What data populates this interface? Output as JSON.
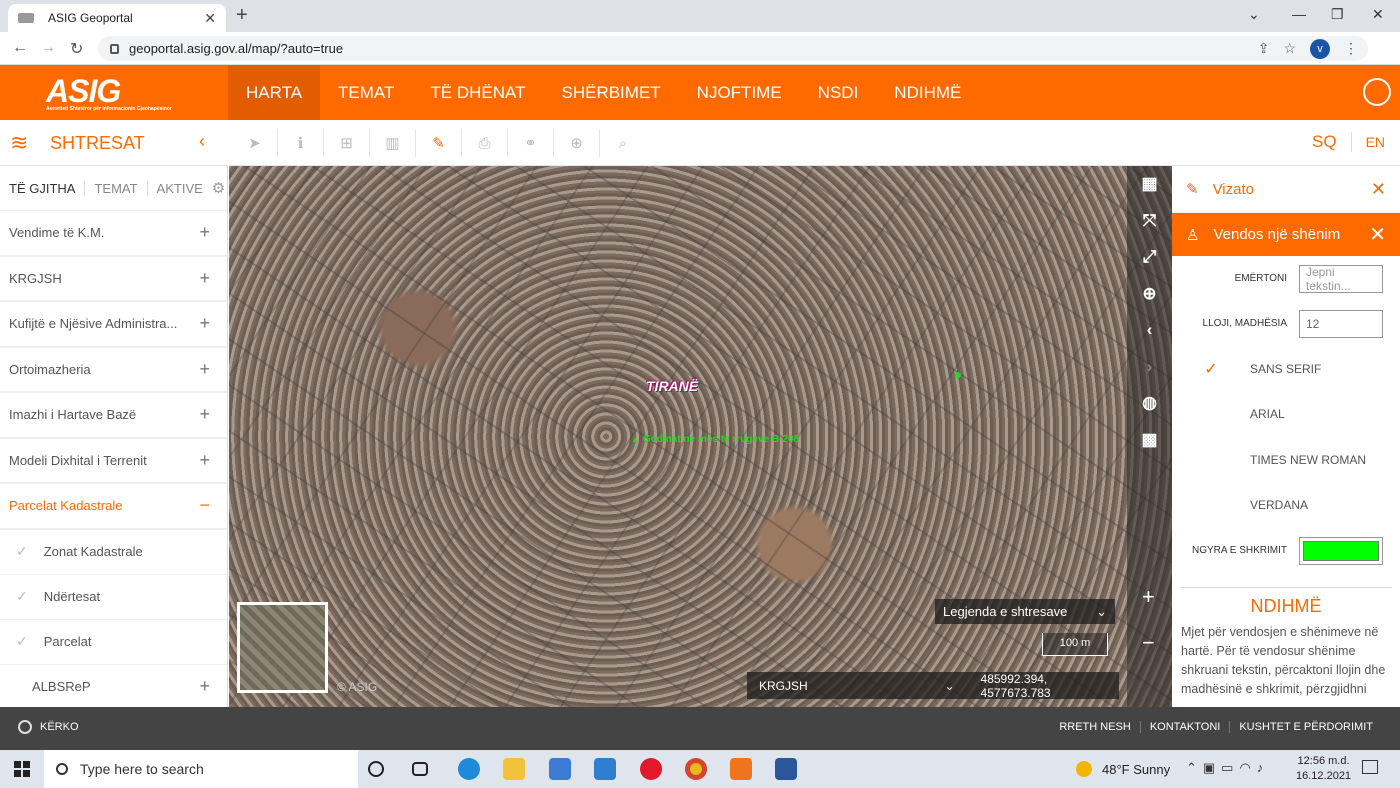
{
  "browser": {
    "tab_title": "ASIG Geoportal",
    "url": "geoportal.asig.gov.al/map/?auto=true",
    "profile_initial": "v"
  },
  "header": {
    "logo_text": "ASIG",
    "logo_subtext": "Autoriteti Shtetëror për Informacionin Gjeohapësinor",
    "nav": [
      "HARTA",
      "TEMAT",
      "TË DHËNAT",
      "SHËRBIMET",
      "NJOFTIME",
      "NSDI",
      "NDIHMË"
    ],
    "active_nav": "HARTA",
    "brand_color": "#ff6a00"
  },
  "toolbar": {
    "layers_title": "SHTRESAT",
    "tools": [
      "pointer-icon",
      "info-icon",
      "add-icon",
      "chart-icon",
      "edit-icon",
      "print-icon",
      "link-icon",
      "plus-circle-icon",
      "search-icon"
    ],
    "lang_sq": "SQ",
    "lang_en": "EN"
  },
  "sidebar": {
    "tabs": [
      "TË GJITHA",
      "TEMAT",
      "AKTIVE"
    ],
    "items": [
      {
        "label": "Vendime të K.M.",
        "toggle": "+"
      },
      {
        "label": "KRGJSH",
        "toggle": "+"
      },
      {
        "label": "Kufijtë e Njësive Administra...",
        "toggle": "+"
      },
      {
        "label": "Ortoimazheria",
        "toggle": "+"
      },
      {
        "label": "Imazhi i Hartave Bazë",
        "toggle": "+"
      },
      {
        "label": "Modeli Dixhital i Terrenit",
        "toggle": "+"
      },
      {
        "label": "Parcelat Kadastrale",
        "toggle": "−"
      }
    ],
    "subitems": [
      "Zonat Kadastrale",
      "Ndërtesat",
      "Parcelat"
    ],
    "last_item": {
      "label": "ALBSReP",
      "toggle": "+"
    }
  },
  "map": {
    "place_label": "TIRANË",
    "green_label": "Godinat ne mes te rrugeve B-208",
    "copyright": "© ASIG",
    "legend_label": "Legjenda e shtresave",
    "scale": "100 m",
    "crs": "KRGJSH",
    "coordinates": "485992.394, 4577673.783",
    "zoom_in": "+",
    "zoom_out": "−"
  },
  "right_panel": {
    "draw_title": "Vizato",
    "note_title": "Vendos një shënim",
    "name_label": "EMËRTONI",
    "name_placeholder": "Jepni tekstin...",
    "size_label": "LLOJI, MADHËSIA",
    "size_value": "12",
    "fonts": [
      "SANS SERIF",
      "ARIAL",
      "TIMES NEW ROMAN",
      "VERDANA"
    ],
    "selected_font": "SANS SERIF",
    "color_label": "NGYRA E SHKRIMIT",
    "text_color": "#00ff00",
    "help_title": "NDIHMË",
    "help_text": "Mjet për vendosjen e shënimeve në hartë. Për të vendosur shënime shkruani tekstin, përcaktoni llojin dhe madhësinë e shkrimit, përzgjidhni"
  },
  "footer": {
    "search_label": "KËRKO",
    "links": [
      "RRETH NESH",
      "KONTAKTONI",
      "KUSHTET E PËRDORIMIT"
    ]
  },
  "taskbar": {
    "search_placeholder": "Type here to search",
    "weather_temp": "48°F",
    "weather_desc": "Sunny",
    "time": "12:56 m.d.",
    "date": "16.12.2021"
  }
}
